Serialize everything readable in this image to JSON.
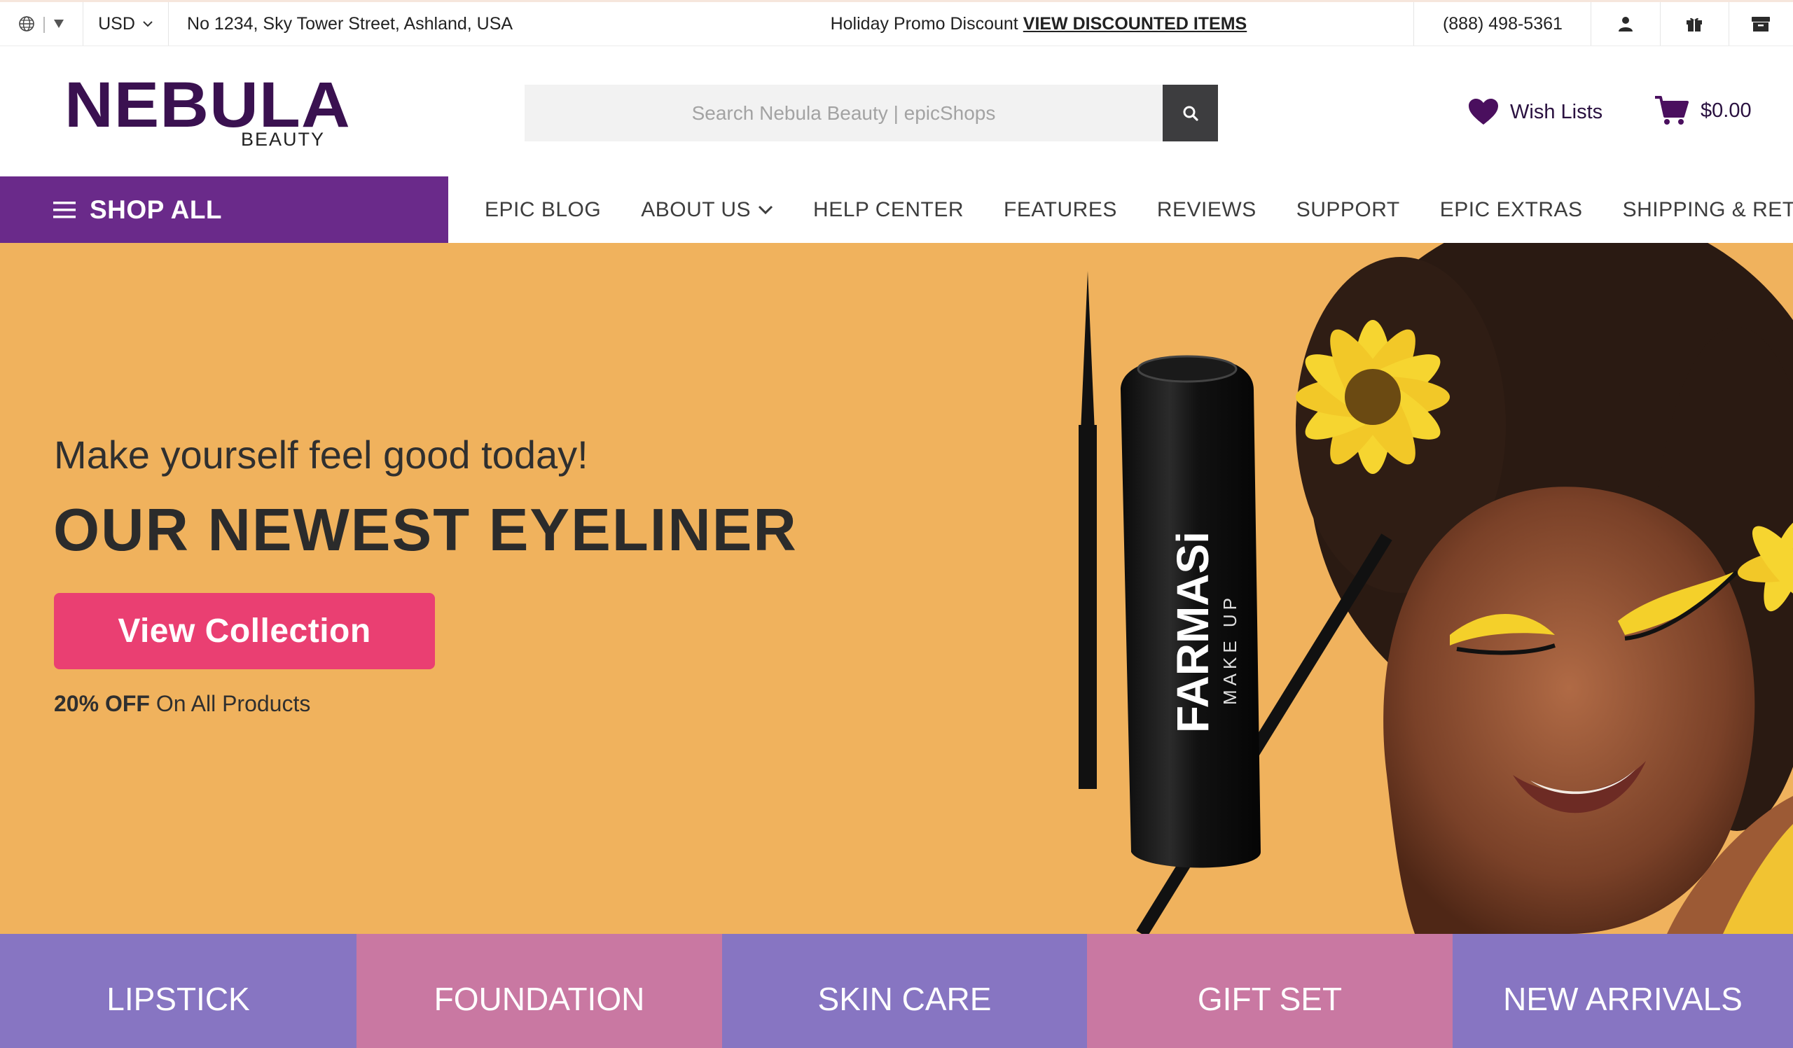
{
  "topbar": {
    "language_icon": "globe-icon",
    "currency": "USD",
    "address": "No 1234, Sky Tower Street, Ashland, USA",
    "promo_text": "Holiday Promo Discount",
    "promo_link": "VIEW DISCOUNTED ITEMS",
    "phone": "(888) 498-5361"
  },
  "header": {
    "logo_main": "NEBULA",
    "logo_sub": "BEAUTY",
    "search_placeholder": "Search Nebula Beauty | epicShops",
    "wish_label": "Wish Lists",
    "cart_total": "$0.00"
  },
  "nav": {
    "shop_all": "SHOP ALL",
    "links": [
      {
        "label": "EPIC BLOG"
      },
      {
        "label": "ABOUT US"
      },
      {
        "label": "HELP CENTER"
      },
      {
        "label": "FEATURES"
      },
      {
        "label": "REVIEWS"
      },
      {
        "label": "SUPPORT"
      },
      {
        "label": "EPIC EXTRAS"
      },
      {
        "label": "SHIPPING & RETURNS"
      }
    ]
  },
  "hero": {
    "subtitle": "Make yourself feel good today!",
    "title": "OUR NEWEST EYELINER",
    "button": "View Collection",
    "offer_bold": "20% OFF",
    "offer_rest": " On All Products",
    "product_brand": "FARMASi",
    "product_line": "MAKE UP"
  },
  "categories": [
    {
      "label": "LIPSTICK"
    },
    {
      "label": "FOUNDATION"
    },
    {
      "label": "SKIN CARE"
    },
    {
      "label": "GIFT SET"
    },
    {
      "label": "NEW ARRIVALS"
    }
  ],
  "colors": {
    "brand_purple": "#6a2a8a",
    "hero_bg": "#f0b25d",
    "cta_pink": "#ea3f72",
    "category_purple": "#8775c2",
    "category_pink": "#c978a2"
  }
}
